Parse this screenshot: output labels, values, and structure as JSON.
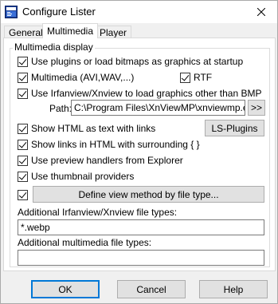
{
  "window": {
    "title": "Configure Lister",
    "app_icon": "lister-icon",
    "close_glyph": "✕"
  },
  "tabs": [
    {
      "label": "General",
      "active": false
    },
    {
      "label": "Multimedia",
      "active": true
    },
    {
      "label": "Player",
      "active": false
    }
  ],
  "group": {
    "label": "Multimedia display"
  },
  "options": {
    "use_plugins": {
      "label": "Use plugins or load bitmaps as graphics at startup",
      "checked": true
    },
    "multimedia": {
      "label": "Multimedia (AVI,WAV,...)",
      "checked": true
    },
    "rtf": {
      "label": "RTF",
      "checked": true
    },
    "irfanview": {
      "label": "Use Irfanview/Xnview to load graphics other than BMP",
      "checked": true
    },
    "show_html": {
      "label": "Show HTML as text with links",
      "checked": true
    },
    "show_links": {
      "label": "Show links in HTML with surrounding { }",
      "checked": true
    },
    "preview_handlers": {
      "label": "Use preview handlers from Explorer",
      "checked": true
    },
    "thumbnail_providers": {
      "label": "Use thumbnail providers",
      "checked": true
    },
    "define_view_method": {
      "checked": true
    }
  },
  "path": {
    "label": "Path:",
    "value": "C:\\Program Files\\XnViewMP\\xnviewmp.exe",
    "browse_label": ">>"
  },
  "buttons": {
    "ls_plugins": "LS-Plugins",
    "define_view": "Define view method by file type...",
    "ok": "OK",
    "cancel": "Cancel",
    "help": "Help"
  },
  "additional_irfanview": {
    "label": "Additional Irfanview/Xnview file types:",
    "value": "*.webp"
  },
  "additional_multimedia": {
    "label": "Additional multimedia file types:",
    "value": ""
  }
}
